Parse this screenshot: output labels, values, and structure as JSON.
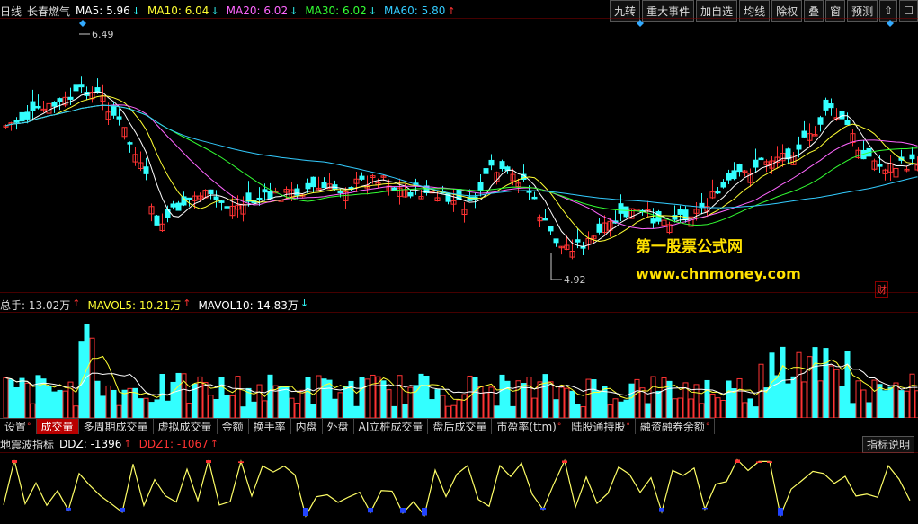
{
  "header": {
    "period": "日线",
    "stock_name": "长春燃气",
    "ma": [
      {
        "label": "MA5: 5.96",
        "color": "#ffffff",
        "dir": "down"
      },
      {
        "label": "MA10: 6.04",
        "color": "#ffff33",
        "dir": "down"
      },
      {
        "label": "MA20: 6.02",
        "color": "#ff66ff",
        "dir": "down"
      },
      {
        "label": "MA30: 6.02",
        "color": "#33ff33",
        "dir": "down"
      },
      {
        "label": "MA60: 5.80",
        "color": "#33ccff",
        "dir": "up"
      }
    ]
  },
  "toolbar": [
    "九转",
    "重大事件",
    "加自选",
    "均线",
    "除权",
    "叠",
    "窗",
    "预测",
    "⇧",
    "☐"
  ],
  "price_chart": {
    "high_label": "6.49",
    "low_label": "4.92",
    "finance_badge": "财",
    "candle_color_up": "#ff3333",
    "candle_color_down": "#33ffff"
  },
  "volume_header": {
    "items": [
      {
        "label": "总手: 13.02万",
        "color": "#33ccff",
        "dir": "up"
      },
      {
        "label": "MAVOL5: 10.21万",
        "color": "#ffff33",
        "dir": "up"
      },
      {
        "label": "MAVOL10: 14.83万",
        "color": "#ffffff",
        "dir": "down"
      }
    ]
  },
  "tabs": [
    {
      "label": "设置",
      "dot": true,
      "active": false
    },
    {
      "label": "成交量",
      "dot": false,
      "active": true
    },
    {
      "label": "多周期成交量",
      "dot": false,
      "active": false
    },
    {
      "label": "虚拟成交量",
      "dot": false,
      "active": false
    },
    {
      "label": "金额",
      "dot": false,
      "active": false
    },
    {
      "label": "换手率",
      "dot": false,
      "active": false
    },
    {
      "label": "内盘",
      "dot": false,
      "active": false
    },
    {
      "label": "外盘",
      "dot": false,
      "active": false
    },
    {
      "label": "AI立桩成交量",
      "dot": false,
      "active": false
    },
    {
      "label": "盘后成交量",
      "dot": false,
      "active": false
    },
    {
      "label": "市盈率(ttm)",
      "dot": true,
      "active": false
    },
    {
      "label": "陆股通持股",
      "dot": true,
      "active": false
    },
    {
      "label": "融资融券余额",
      "dot": true,
      "active": false
    }
  ],
  "indicator_header": {
    "name": "地震波指标",
    "items": [
      {
        "label": "DDZ: -1396",
        "color": "#ffffff",
        "dir": "up"
      },
      {
        "label": "DDZ1: -1067",
        "color": "#ff3333",
        "dir": "up"
      }
    ],
    "explain_button": "指标说明"
  },
  "watermark": {
    "line1": "第一股票公式网",
    "line2": "www.chnmoney.com"
  }
}
